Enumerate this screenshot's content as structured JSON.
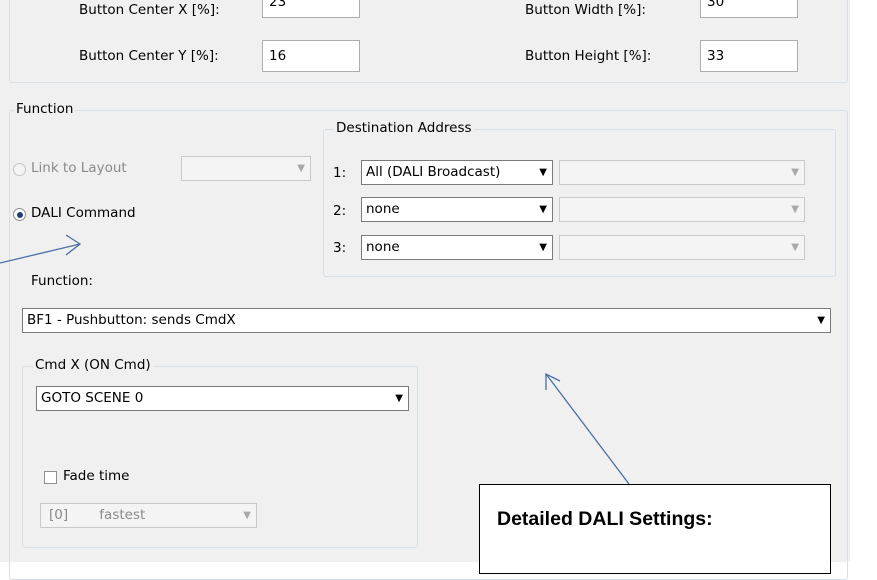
{
  "position_group": {
    "center_x_label": "Button Center X [%]:",
    "center_x_value": "23",
    "width_label": "Button Width [%]:",
    "width_value": "30",
    "center_y_label": "Button Center Y [%]:",
    "center_y_value": "16",
    "height_label": "Button Height [%]:",
    "height_value": "33"
  },
  "function_group": {
    "legend": "Function",
    "link_to_layout_label": "Link to Layout",
    "link_to_layout_value": "",
    "dali_command_label": "DALI Command",
    "selected_mode": "DALI Command",
    "function_label": "Function:",
    "function_value": "BF1 - Pushbutton:  sends CmdX"
  },
  "destination": {
    "legend": "Destination Address",
    "rows": [
      {
        "index": "1:",
        "value": "All (DALI Broadcast)",
        "secondary": ""
      },
      {
        "index": "2:",
        "value": "none",
        "secondary": ""
      },
      {
        "index": "3:",
        "value": "none",
        "secondary": ""
      }
    ]
  },
  "cmdx_group": {
    "legend": "Cmd X  (ON Cmd)",
    "command_value": "GOTO SCENE 0",
    "fade_time_label": "Fade time",
    "fade_time_checked": false,
    "fade_index": "[0]",
    "fade_value": "fastest"
  },
  "annotation": {
    "callout_text": "Detailed DALI Settings:",
    "line_color": "#4a6fa5"
  },
  "icons": {
    "dropdown": "▼"
  }
}
